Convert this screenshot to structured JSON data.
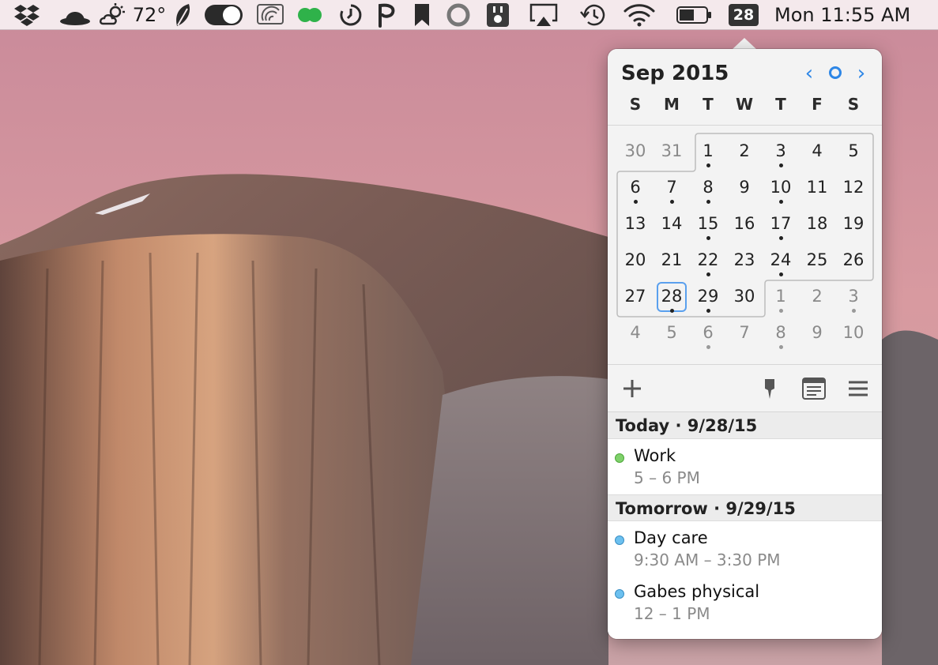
{
  "menubar": {
    "weather_temp": "72°",
    "calendar_badge": "28",
    "clock": "Mon 11:55 AM",
    "icons": [
      "dropbox-icon",
      "hat-icon",
      "weather-icon",
      "feather-icon",
      "toggle-icon",
      "wifi-monitor-icon",
      "green-circles-icon",
      "timer-icon",
      "p-icon",
      "bookmark-icon",
      "circle-icon",
      "plug-icon",
      "airplay-icon",
      "time-machine-icon",
      "wifi-icon",
      "battery-icon"
    ]
  },
  "calendar": {
    "month_title": "Sep 2015",
    "prev_label": "‹",
    "next_label": "›",
    "weekdays": [
      "S",
      "M",
      "T",
      "W",
      "T",
      "F",
      "S"
    ],
    "weeks": [
      [
        {
          "d": "30",
          "o": true,
          "e": false
        },
        {
          "d": "31",
          "o": true,
          "e": false
        },
        {
          "d": "1",
          "o": false,
          "e": true
        },
        {
          "d": "2",
          "o": false,
          "e": false
        },
        {
          "d": "3",
          "o": false,
          "e": true
        },
        {
          "d": "4",
          "o": false,
          "e": false
        },
        {
          "d": "5",
          "o": false,
          "e": false
        }
      ],
      [
        {
          "d": "6",
          "o": false,
          "e": true
        },
        {
          "d": "7",
          "o": false,
          "e": true
        },
        {
          "d": "8",
          "o": false,
          "e": true
        },
        {
          "d": "9",
          "o": false,
          "e": false
        },
        {
          "d": "10",
          "o": false,
          "e": true
        },
        {
          "d": "11",
          "o": false,
          "e": false
        },
        {
          "d": "12",
          "o": false,
          "e": false
        }
      ],
      [
        {
          "d": "13",
          "o": false,
          "e": false
        },
        {
          "d": "14",
          "o": false,
          "e": false
        },
        {
          "d": "15",
          "o": false,
          "e": true
        },
        {
          "d": "16",
          "o": false,
          "e": false
        },
        {
          "d": "17",
          "o": false,
          "e": true
        },
        {
          "d": "18",
          "o": false,
          "e": false
        },
        {
          "d": "19",
          "o": false,
          "e": false
        }
      ],
      [
        {
          "d": "20",
          "o": false,
          "e": false
        },
        {
          "d": "21",
          "o": false,
          "e": false
        },
        {
          "d": "22",
          "o": false,
          "e": true
        },
        {
          "d": "23",
          "o": false,
          "e": false
        },
        {
          "d": "24",
          "o": false,
          "e": true
        },
        {
          "d": "25",
          "o": false,
          "e": false
        },
        {
          "d": "26",
          "o": false,
          "e": false
        }
      ],
      [
        {
          "d": "27",
          "o": false,
          "e": false
        },
        {
          "d": "28",
          "o": false,
          "e": true,
          "today": true
        },
        {
          "d": "29",
          "o": false,
          "e": true
        },
        {
          "d": "30",
          "o": false,
          "e": false
        },
        {
          "d": "1",
          "o": true,
          "e": true
        },
        {
          "d": "2",
          "o": true,
          "e": false
        },
        {
          "d": "3",
          "o": true,
          "e": true
        }
      ],
      [
        {
          "d": "4",
          "o": true,
          "e": false
        },
        {
          "d": "5",
          "o": true,
          "e": false
        },
        {
          "d": "6",
          "o": true,
          "e": true
        },
        {
          "d": "7",
          "o": true,
          "e": false
        },
        {
          "d": "8",
          "o": true,
          "e": true
        },
        {
          "d": "9",
          "o": true,
          "e": false
        },
        {
          "d": "10",
          "o": true,
          "e": false
        }
      ]
    ]
  },
  "toolbar": {
    "add_label": "+",
    "icons": [
      "add-icon",
      "pin-icon",
      "notes-icon",
      "menu-icon"
    ]
  },
  "agenda": {
    "today_header": "Today  ·  9/28/15",
    "tomorrow_header": "Tomorrow  ·  9/29/15",
    "today_events": [
      {
        "title": "Work",
        "time": "5 – 6 PM",
        "color": "#7fd16b"
      }
    ],
    "tomorrow_events": [
      {
        "title": "Day care",
        "time": "9:30 AM – 3:30 PM",
        "color": "#6cc0ef"
      },
      {
        "title": "Gabes physical",
        "time": "12 – 1 PM",
        "color": "#6cc0ef"
      }
    ]
  },
  "colors": {
    "accent": "#2d86e6",
    "today_ring": "#5aa0ee",
    "menubar_bg": "#f4e9ec"
  }
}
